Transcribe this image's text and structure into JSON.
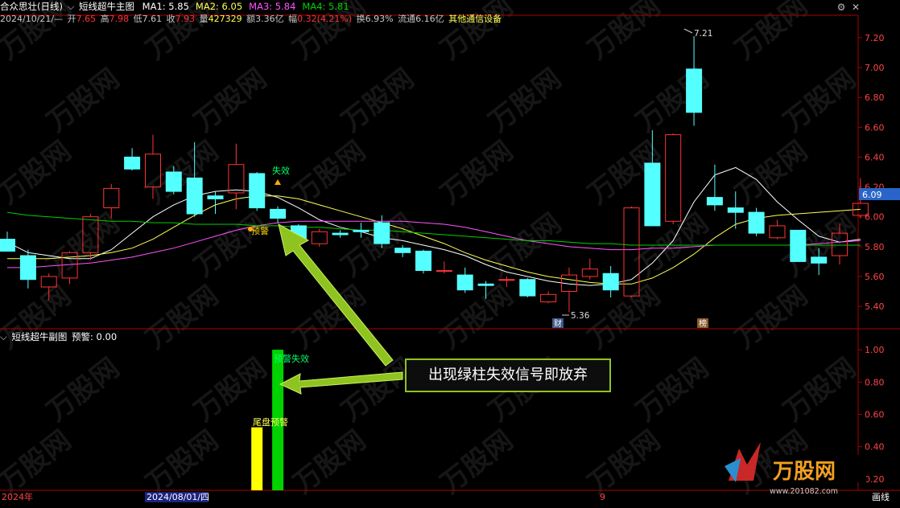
{
  "colors": {
    "up": "#ff3333",
    "down": "#54ffff",
    "ma1": "#ffffff",
    "ma2": "#ffff54",
    "ma3": "#ff54ff",
    "ma4": "#00d000",
    "axis": "#aa0000",
    "text_grey": "#c8c8c8"
  },
  "header": {
    "title": "合众思壮(日线)",
    "indicator_name": "短线超牛主图",
    "ma": [
      {
        "label": "MA1: 5.85",
        "color": "#ffffff"
      },
      {
        "label": "MA2: 6.05",
        "color": "#ffff54"
      },
      {
        "label": "MA3: 5.84",
        "color": "#ff54ff"
      },
      {
        "label": "MA4: 5.81",
        "color": "#00d000"
      }
    ],
    "quote": {
      "date": "2024/10/21/—",
      "open_label": "开",
      "open": "7.65",
      "high_label": "高",
      "high": "7.98",
      "low_label": "低",
      "low": "7.61",
      "close_label": "收",
      "close": "7.93",
      "vol_label": "量",
      "vol": "427329",
      "amt_label": "额",
      "amt": "3.36亿",
      "chg_label": "幅",
      "chg": "0.32(4.21%)",
      "turn": "换6.93%",
      "float": "流通6.16亿",
      "sector": "其他通信设备"
    }
  },
  "sub_header": {
    "name": "短线超牛副图",
    "label": "预警: 0.00"
  },
  "window_buttons": {
    "gear": "⚙",
    "close": "✕"
  },
  "main_annotations": {
    "fail_label": "失效",
    "warn_label": "预警",
    "low_mark": "5.36",
    "high_mark": "7.21",
    "last_price": "6.09",
    "badge_cai": "财",
    "badge_bang": "榜"
  },
  "sub_annotations": {
    "fail_label": "预警失效",
    "tail_label": "尾盘预警"
  },
  "callout": {
    "text": "出现绿柱失效信号即放弃"
  },
  "bottom_bar": {
    "year": "2024年",
    "date_cursor": "2024/08/01/四",
    "month_9": "9",
    "right_tab": "画线"
  },
  "watermark": {
    "brand": "万股网",
    "url": "www.201082.com"
  },
  "chart_data": [
    {
      "type": "candlestick",
      "title": "短线超牛主图",
      "ylim": [
        5.25,
        7.35
      ],
      "yticks": [
        "7.20",
        "7.00",
        "6.80",
        "6.60",
        "6.40",
        "6.20",
        "6.00",
        "5.80",
        "5.60",
        "5.40"
      ],
      "candles": [
        {
          "o": 5.85,
          "h": 5.9,
          "l": 5.8,
          "c": 5.77
        },
        {
          "o": 5.74,
          "h": 5.78,
          "l": 5.52,
          "c": 5.58
        },
        {
          "o": 5.53,
          "h": 5.62,
          "l": 5.44,
          "c": 5.6
        },
        {
          "o": 5.59,
          "h": 5.77,
          "l": 5.55,
          "c": 5.76
        },
        {
          "o": 5.76,
          "h": 6.02,
          "l": 5.71,
          "c": 6.0
        },
        {
          "o": 6.06,
          "h": 6.22,
          "l": 5.99,
          "c": 6.19
        },
        {
          "o": 6.4,
          "h": 6.46,
          "l": 6.31,
          "c": 6.32
        },
        {
          "o": 6.2,
          "h": 6.55,
          "l": 6.12,
          "c": 6.42
        },
        {
          "o": 6.3,
          "h": 6.34,
          "l": 6.15,
          "c": 6.17
        },
        {
          "o": 6.26,
          "h": 6.5,
          "l": 6.0,
          "c": 6.02
        },
        {
          "o": 6.14,
          "h": 6.17,
          "l": 6.02,
          "c": 6.12
        },
        {
          "o": 6.16,
          "h": 6.49,
          "l": 6.05,
          "c": 6.35
        },
        {
          "o": 6.29,
          "h": 6.3,
          "l": 6.04,
          "c": 6.06
        },
        {
          "o": 6.05,
          "h": 6.07,
          "l": 5.96,
          "c": 5.99
        },
        {
          "o": 5.94,
          "h": 5.95,
          "l": 5.83,
          "c": 5.84
        },
        {
          "o": 5.82,
          "h": 5.92,
          "l": 5.8,
          "c": 5.9
        },
        {
          "o": 5.89,
          "h": 5.91,
          "l": 5.86,
          "c": 5.88
        },
        {
          "o": 5.91,
          "h": 5.96,
          "l": 5.86,
          "c": 5.9
        },
        {
          "o": 5.96,
          "h": 6.01,
          "l": 5.79,
          "c": 5.82
        },
        {
          "o": 5.79,
          "h": 5.81,
          "l": 5.73,
          "c": 5.76
        },
        {
          "o": 5.77,
          "h": 5.78,
          "l": 5.62,
          "c": 5.64
        },
        {
          "o": 5.64,
          "h": 5.7,
          "l": 5.62,
          "c": 5.64
        },
        {
          "o": 5.61,
          "h": 5.66,
          "l": 5.49,
          "c": 5.51
        },
        {
          "o": 5.55,
          "h": 5.57,
          "l": 5.45,
          "c": 5.54
        },
        {
          "o": 5.58,
          "h": 5.6,
          "l": 5.53,
          "c": 5.58
        },
        {
          "o": 5.58,
          "h": 5.59,
          "l": 5.46,
          "c": 5.47
        },
        {
          "o": 5.43,
          "h": 5.5,
          "l": 5.42,
          "c": 5.48
        },
        {
          "o": 5.5,
          "h": 5.66,
          "l": 5.36,
          "c": 5.61
        },
        {
          "o": 5.6,
          "h": 5.72,
          "l": 5.58,
          "c": 5.65
        },
        {
          "o": 5.62,
          "h": 5.67,
          "l": 5.46,
          "c": 5.51
        },
        {
          "o": 5.47,
          "h": 6.07,
          "l": 5.46,
          "c": 6.06
        },
        {
          "o": 6.36,
          "h": 6.58,
          "l": 5.95,
          "c": 5.94
        },
        {
          "o": 5.97,
          "h": 6.56,
          "l": 5.95,
          "c": 6.55
        },
        {
          "o": 6.99,
          "h": 7.21,
          "l": 6.61,
          "c": 6.7
        },
        {
          "o": 6.13,
          "h": 6.35,
          "l": 6.04,
          "c": 6.08
        },
        {
          "o": 6.06,
          "h": 6.17,
          "l": 5.92,
          "c": 6.03
        },
        {
          "o": 6.03,
          "h": 6.06,
          "l": 5.87,
          "c": 5.89
        },
        {
          "o": 5.86,
          "h": 5.98,
          "l": 5.85,
          "c": 5.94
        },
        {
          "o": 5.91,
          "h": 5.91,
          "l": 5.7,
          "c": 5.7
        },
        {
          "o": 5.73,
          "h": 5.79,
          "l": 5.61,
          "c": 5.69
        },
        {
          "o": 5.74,
          "h": 5.95,
          "l": 5.68,
          "c": 5.89
        },
        {
          "o": 6.01,
          "h": 6.26,
          "l": 5.99,
          "c": 6.09
        }
      ],
      "ma_series": [
        {
          "name": "MA1",
          "color": "#ffffff",
          "values": [
            5.83,
            5.76,
            5.74,
            5.72,
            5.72,
            5.78,
            5.89,
            6.0,
            6.08,
            6.14,
            6.17,
            6.18,
            6.17,
            6.13,
            6.06,
            5.98,
            5.93,
            5.9,
            5.86,
            5.84,
            5.81,
            5.78,
            5.74,
            5.68,
            5.63,
            5.6,
            5.57,
            5.55,
            5.54,
            5.55,
            5.58,
            5.69,
            5.84,
            6.1,
            6.28,
            6.33,
            6.25,
            6.1,
            5.98,
            5.87,
            5.83,
            5.85
          ]
        },
        {
          "name": "MA2",
          "color": "#ffff54",
          "values": [
            5.72,
            5.72,
            5.72,
            5.73,
            5.74,
            5.76,
            5.79,
            5.85,
            5.93,
            6.01,
            6.08,
            6.12,
            6.14,
            6.14,
            6.12,
            6.08,
            6.04,
            6.0,
            5.96,
            5.92,
            5.87,
            5.82,
            5.76,
            5.71,
            5.67,
            5.63,
            5.6,
            5.58,
            5.56,
            5.55,
            5.55,
            5.59,
            5.66,
            5.75,
            5.86,
            5.95,
            5.99,
            6.01,
            6.02,
            6.03,
            6.04,
            6.05
          ]
        },
        {
          "name": "MA3",
          "color": "#ff54ff",
          "values": [
            5.66,
            5.66,
            5.67,
            5.68,
            5.69,
            5.71,
            5.73,
            5.76,
            5.79,
            5.83,
            5.87,
            5.91,
            5.94,
            5.96,
            5.97,
            5.97,
            5.97,
            5.97,
            5.97,
            5.97,
            5.96,
            5.95,
            5.93,
            5.9,
            5.87,
            5.84,
            5.82,
            5.8,
            5.79,
            5.78,
            5.78,
            5.79,
            5.79,
            5.8,
            5.81,
            5.81,
            5.81,
            5.81,
            5.81,
            5.82,
            5.83,
            5.84
          ]
        },
        {
          "name": "MA4",
          "color": "#00d000",
          "values": [
            6.03,
            6.01,
            6.0,
            5.99,
            5.98,
            5.97,
            5.97,
            5.96,
            5.96,
            5.95,
            5.95,
            5.95,
            5.94,
            5.94,
            5.93,
            5.93,
            5.92,
            5.91,
            5.91,
            5.9,
            5.89,
            5.88,
            5.87,
            5.86,
            5.85,
            5.84,
            5.84,
            5.83,
            5.82,
            5.82,
            5.81,
            5.81,
            5.81,
            5.81,
            5.81,
            5.81,
            5.81,
            5.81,
            5.81,
            5.81,
            5.81,
            5.81
          ]
        }
      ]
    },
    {
      "type": "bar",
      "title": "短线超牛副图",
      "ylim": [
        0.13,
        1.13
      ],
      "yticks": [
        "1.00",
        "0.80",
        "0.60",
        "0.40",
        "0.20"
      ],
      "bars": [
        {
          "index": 12,
          "value": 0.52,
          "color": "#ffff00",
          "label": "尾盘预警"
        },
        {
          "index": 13,
          "value": 1.0,
          "color": "#00d200",
          "label": "预警失效"
        }
      ]
    }
  ]
}
